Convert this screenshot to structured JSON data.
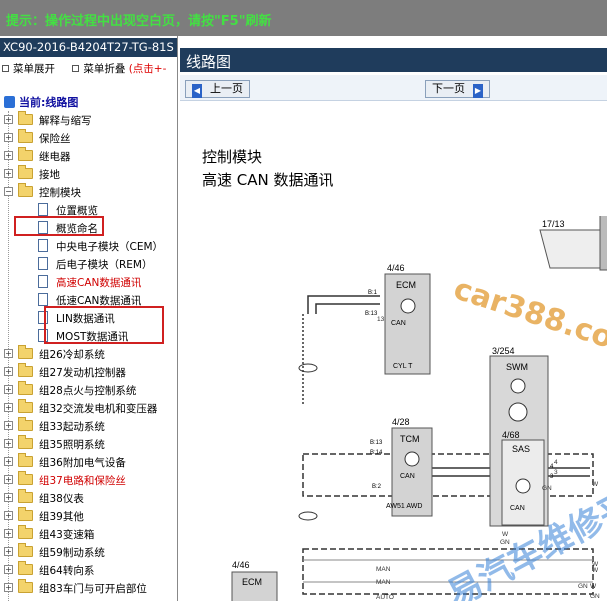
{
  "hint": "提示：操作过程中出现空白页，请按\"F5\"刷新",
  "doc_id": "XC90-2016-B4204T27-TG-81S",
  "menu": {
    "expand": "菜单展开",
    "collapse": "菜单折叠",
    "collapse_hint": "(点击+-"
  },
  "tree_root": "当前:线路图",
  "tree": [
    {
      "label": "解释与缩写",
      "type": "folder",
      "expanded": false
    },
    {
      "label": "保险丝",
      "type": "folder",
      "expanded": false
    },
    {
      "label": "继电器",
      "type": "folder",
      "expanded": false
    },
    {
      "label": "接地",
      "type": "folder",
      "expanded": false
    },
    {
      "label": "控制模块",
      "type": "folder",
      "expanded": true,
      "highlighted": true
    },
    {
      "label": "位置概览",
      "type": "page"
    },
    {
      "label": "概览命名",
      "type": "page"
    },
    {
      "label": "中央电子模块（CEM）",
      "type": "page"
    },
    {
      "label": "后电子模块（REM）",
      "type": "page"
    },
    {
      "label": "高速CAN数据通讯",
      "type": "page",
      "selected": true,
      "color": "#d00000"
    },
    {
      "label": "低速CAN数据通讯",
      "type": "page"
    },
    {
      "label": "LIN数据通讯",
      "type": "page"
    },
    {
      "label": "MOST数据通讯",
      "type": "page"
    },
    {
      "label": "组26冷却系统",
      "type": "folder"
    },
    {
      "label": "组27发动机控制器",
      "type": "folder"
    },
    {
      "label": "组28点火与控制系统",
      "type": "folder"
    },
    {
      "label": "组32交流发电机和变压器",
      "type": "folder"
    },
    {
      "label": "组33起动系统",
      "type": "folder"
    },
    {
      "label": "组35照明系统",
      "type": "folder"
    },
    {
      "label": "组36附加电气设备",
      "type": "folder"
    },
    {
      "label": "组37电路和保险丝",
      "type": "folder",
      "color": "#d00000"
    },
    {
      "label": "组38仪表",
      "type": "folder"
    },
    {
      "label": "组39其他",
      "type": "folder"
    },
    {
      "label": "组43变速箱",
      "type": "folder"
    },
    {
      "label": "组59制动系统",
      "type": "folder"
    },
    {
      "label": "组64转向系",
      "type": "folder"
    },
    {
      "label": "组83车门与可开启部位",
      "type": "folder"
    }
  ],
  "main": {
    "title": "线路图",
    "prev": "上一页",
    "next": "下一页",
    "heading1": "控制模块",
    "heading2": "高速 CAN 数据通讯"
  },
  "diagram": {
    "ecm_top": {
      "code": "4/46",
      "name": "ECM",
      "pin1": "B:1",
      "pin2": "B:13",
      "can": "CAN",
      "bottom": "CYL T"
    },
    "tcm": {
      "code": "4/28",
      "name": "TCM",
      "pin1": "B:13",
      "pin2": "B:14",
      "pin3": "B:2",
      "can": "CAN",
      "bottom": "AW51 AWD"
    },
    "swm": {
      "code": "3/254",
      "name": "SWM"
    },
    "sas": {
      "code": "4/68",
      "name": "SAS",
      "can": "CAN",
      "pin1": "4",
      "pin2": "3"
    },
    "conn": {
      "code": "17/13"
    },
    "ecm_bottom": {
      "code": "4/46",
      "name": "ECM"
    },
    "wire_labels": [
      "GN",
      "W",
      "GN",
      "W",
      "MAN",
      "MAN",
      "AUTO",
      "W",
      "GN",
      "W",
      "W",
      "GN",
      "13",
      "3",
      "4"
    ]
  },
  "watermark": {
    "site": "car388.com",
    "platform": "易汽车维修平台"
  },
  "colors": {
    "title_bar": "#1f3c5c",
    "top_bar": "#7d7d7d",
    "hint_text": "#43e043",
    "highlight": "#d02020",
    "selected_text": "#d00000"
  }
}
